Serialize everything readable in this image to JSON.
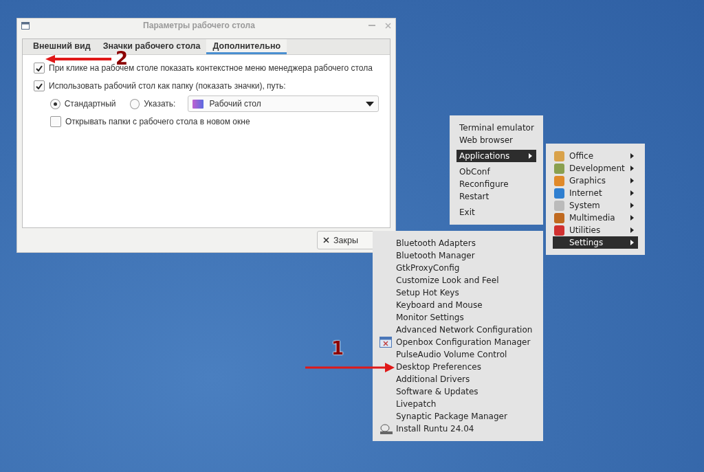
{
  "dialog": {
    "title": "Параметры рабочего стола",
    "tabs": [
      {
        "label": "Внешний вид",
        "selected": false
      },
      {
        "label": "Значки рабочего стола",
        "selected": false
      },
      {
        "label": "Дополнительно",
        "selected": true
      }
    ],
    "checkboxes": [
      {
        "label": "При клике на рабочем столе показать контекстное меню менеджера рабочего стола",
        "checked": true
      },
      {
        "label": "Использовать рабочий стол как папку (показать значки), путь:",
        "checked": true
      }
    ],
    "path_options": [
      {
        "label": "Стандартный",
        "selected": true
      },
      {
        "label": "Указать:",
        "selected": false
      }
    ],
    "folder_dropdown": {
      "value": "Рабочий стол"
    },
    "open_in_new_window": {
      "label": "Открывать папки с рабочего стола в новом окне",
      "checked": false
    },
    "close_button": "Закры"
  },
  "root_menu": {
    "items": [
      {
        "kind": "item",
        "label": "Terminal emulator",
        "selected": false
      },
      {
        "kind": "item",
        "label": "Web browser",
        "selected": false
      },
      {
        "kind": "separator"
      },
      {
        "kind": "submenu",
        "label": "Applications",
        "selected": true
      },
      {
        "kind": "separator"
      },
      {
        "kind": "item",
        "label": "ObConf",
        "selected": false
      },
      {
        "kind": "item",
        "label": "Reconfigure",
        "selected": false
      },
      {
        "kind": "item",
        "label": "Restart",
        "selected": false
      },
      {
        "kind": "separator"
      },
      {
        "kind": "item",
        "label": "Exit",
        "selected": false
      }
    ]
  },
  "applications_menu": {
    "items": [
      {
        "kind": "submenu",
        "label": "Office",
        "selected": false
      },
      {
        "kind": "submenu",
        "label": "Development",
        "selected": false
      },
      {
        "kind": "submenu",
        "label": "Graphics",
        "selected": false
      },
      {
        "kind": "submenu",
        "label": "Internet",
        "selected": false
      },
      {
        "kind": "submenu",
        "label": "System",
        "selected": false
      },
      {
        "kind": "submenu",
        "label": "Multimedia",
        "selected": false
      },
      {
        "kind": "submenu",
        "label": "Utilities",
        "selected": false
      },
      {
        "kind": "submenu",
        "label": "Settings",
        "selected": true
      }
    ]
  },
  "settings_menu": {
    "items": [
      {
        "kind": "item",
        "label": "Bluetooth Adapters"
      },
      {
        "kind": "item",
        "label": "Bluetooth Manager"
      },
      {
        "kind": "item",
        "label": "GtkProxyConfig"
      },
      {
        "kind": "item",
        "label": "Customize Look and Feel"
      },
      {
        "kind": "item",
        "label": "Setup Hot Keys"
      },
      {
        "kind": "item",
        "label": "Keyboard and Mouse"
      },
      {
        "kind": "item",
        "label": "Monitor Settings"
      },
      {
        "kind": "item",
        "label": "Advanced Network Configuration"
      },
      {
        "kind": "item",
        "label": "Openbox Configuration Manager"
      },
      {
        "kind": "item",
        "label": "PulseAudio Volume Control"
      },
      {
        "kind": "item",
        "label": "Desktop Preferences"
      },
      {
        "kind": "item",
        "label": "Additional Drivers"
      },
      {
        "kind": "item",
        "label": "Software & Updates"
      },
      {
        "kind": "item",
        "label": "Livepatch"
      },
      {
        "kind": "item",
        "label": "Synaptic Package Manager"
      },
      {
        "kind": "item",
        "label": "Install Runtu 24.04"
      }
    ]
  },
  "annotations": [
    {
      "label": "2"
    },
    {
      "label": "1"
    }
  ]
}
